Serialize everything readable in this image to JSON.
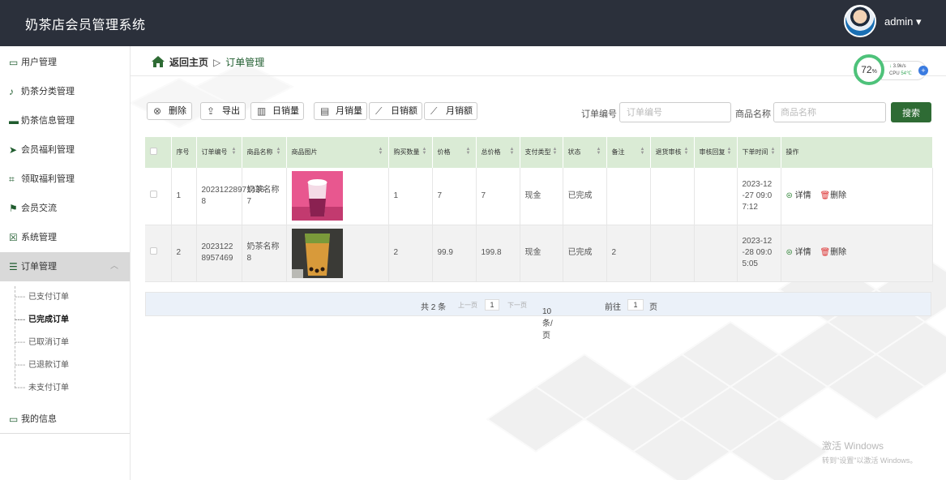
{
  "app": {
    "title": "奶茶店会员管理系统",
    "user": "admin ▾"
  },
  "sidebar": {
    "items": [
      {
        "label": "用户管理",
        "icon": "id-card-icon",
        "glyph": "▭"
      },
      {
        "label": "奶茶分类管理",
        "icon": "microphone-icon",
        "glyph": "♪"
      },
      {
        "label": "奶茶信息管理",
        "icon": "bookmark-icon",
        "glyph": "▬"
      },
      {
        "label": "会员福利管理",
        "icon": "send-icon",
        "glyph": "➤"
      },
      {
        "label": "领取福利管理",
        "icon": "crop-icon",
        "glyph": "⌗"
      },
      {
        "label": "会员交流",
        "icon": "flag-icon",
        "glyph": "⚑"
      },
      {
        "label": "系统管理",
        "icon": "delete-box-icon",
        "glyph": "☒"
      },
      {
        "label": "订单管理",
        "icon": "sliders-icon",
        "glyph": "☰"
      }
    ],
    "subitems": [
      "已支付订单",
      "已完成订单",
      "已取消订单",
      "已退款订单",
      "未支付订单"
    ],
    "my_info": "我的信息"
  },
  "breadcrumb": {
    "back": "返回主页",
    "sep": "▷",
    "current": "订单管理"
  },
  "cpu_widget": {
    "percent": "72",
    "unit": "%",
    "speed": "3.9k/s",
    "cpu_label": "CPU",
    "temp": "54℃",
    "plus": "+"
  },
  "toolbar": {
    "buttons": [
      {
        "label": "删除",
        "icon": "close-circle-icon",
        "glyph": "⊗"
      },
      {
        "label": "导出",
        "icon": "export-icon",
        "glyph": "⇪"
      },
      {
        "label": "日销量",
        "icon": "bar-chart-icon",
        "glyph": "▥"
      },
      {
        "label": "月销量",
        "icon": "calendar-chart-icon",
        "glyph": "▤"
      },
      {
        "label": "日销额",
        "icon": "line-chart-icon",
        "glyph": "⟋"
      },
      {
        "label": "月销额",
        "icon": "trend-chart-icon",
        "glyph": "⟋"
      }
    ]
  },
  "search": {
    "order_no_label": "订单编号",
    "order_no_placeholder": "订单编号",
    "product_label": "商品名称",
    "product_placeholder": "商品名称",
    "button": "搜索"
  },
  "table": {
    "headers": [
      "序号",
      "订单编号",
      "商品名称",
      "商品图片",
      "购买数量",
      "价格",
      "总价格",
      "支付类型",
      "状态",
      "备注",
      "退货审核",
      "审核回复",
      "下单时间",
      "操作"
    ],
    "rows": [
      {
        "index": "1",
        "order_no": "20231228971436 8",
        "name": "奶茶名称 7",
        "qty": "1",
        "price": "7",
        "total": "7",
        "pay": "现金",
        "status": "已完成",
        "note": "",
        "return_review": "",
        "review_reply": "",
        "time": "2023-12 -27 09:0 7:12"
      },
      {
        "index": "2",
        "order_no": "2023122 8957469",
        "name": "奶茶名称 8",
        "qty": "2",
        "price": "99.9",
        "total": "199.8",
        "pay": "现金",
        "status": "已完成",
        "note": "2",
        "return_review": "",
        "review_reply": "",
        "time": "2023-12 -28 09:0 5:05"
      }
    ],
    "actions": {
      "detail": "详情",
      "delete": "删除"
    }
  },
  "pagination": {
    "total": "共 2 条",
    "prev": "上一页",
    "page": "1",
    "next": "下一页",
    "page_size": "10条/页",
    "goto_label": "前往",
    "goto_page": "1",
    "page_unit": "页"
  },
  "watermark": {
    "line1": "激活 Windows",
    "line2": "转到\"设置\"以激活 Windows。"
  },
  "colors": {
    "topbar": "#2b303b",
    "accent": "#2e6b34",
    "table_header": "#daebd5",
    "ring": "#4ec27a"
  }
}
